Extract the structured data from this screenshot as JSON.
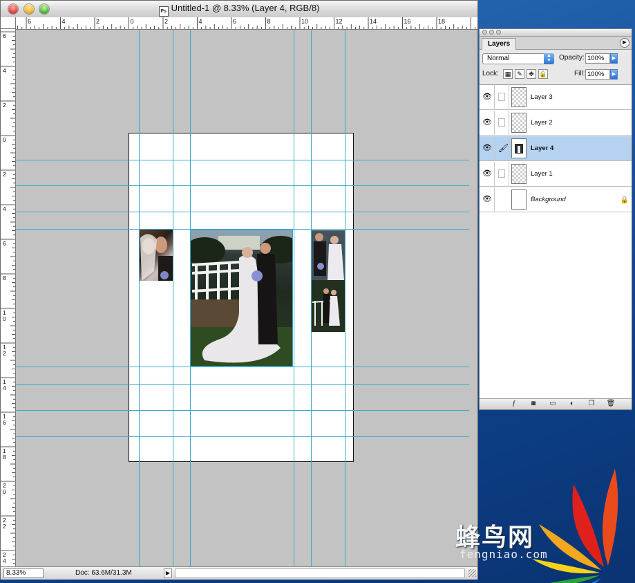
{
  "document": {
    "title": "Untitled-1 @ 8.33% (Layer 4, RGB/8)",
    "icon": "photoshop-document-icon",
    "zoom": "8.33%",
    "doc_size": "Doc: 63.6M/31.3M"
  },
  "rulers": {
    "top": [
      "6",
      "4",
      "2",
      "0",
      "2",
      "4",
      "6",
      "8",
      "10",
      "12",
      "14",
      "16",
      "18"
    ],
    "left": [
      "6",
      "4",
      "2",
      "0",
      "2",
      "4",
      "6",
      "8",
      "10",
      "12",
      "14",
      "16",
      "18",
      "20",
      "22",
      "24"
    ]
  },
  "layers_panel": {
    "tab": "Layers",
    "blend_mode": "Normal",
    "opacity_label": "Opacity:",
    "opacity": "100%",
    "lock_label": "Lock:",
    "fill_label": "Fill:",
    "fill": "100%",
    "layers": [
      {
        "name": "Layer 3",
        "visible": true,
        "selected": false
      },
      {
        "name": "Layer 2",
        "visible": true,
        "selected": false
      },
      {
        "name": "Layer 4",
        "visible": true,
        "selected": true
      },
      {
        "name": "Layer 1",
        "visible": true,
        "selected": false
      },
      {
        "name": "Background",
        "visible": true,
        "selected": false,
        "locked": true
      }
    ]
  },
  "watermark": {
    "text": "蜂鸟网",
    "sub": "fengniao.com"
  },
  "colors": {
    "guide": "#3aa9c8",
    "selected_layer": "#b5d2f0"
  }
}
